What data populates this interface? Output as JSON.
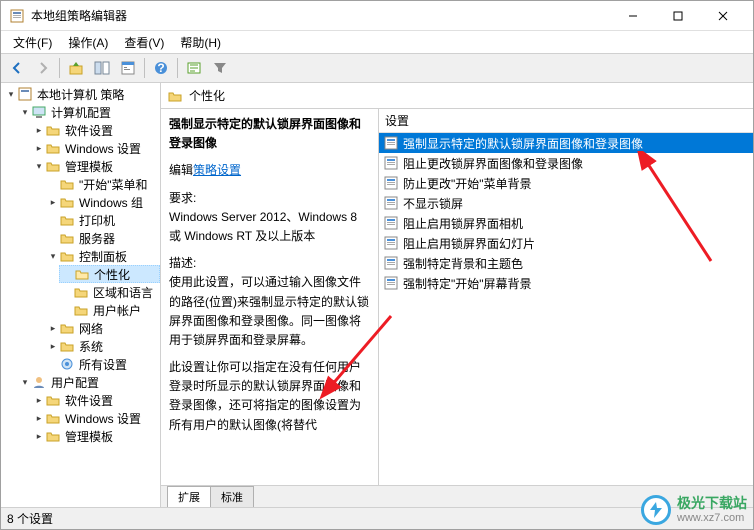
{
  "window": {
    "title": "本地组策略编辑器",
    "min": "—",
    "max": "☐",
    "close": "✕"
  },
  "menu": {
    "file": "文件(F)",
    "action": "操作(A)",
    "view": "查看(V)",
    "help": "帮助(H)"
  },
  "tree": {
    "root": "本地计算机 策略",
    "computer": "计算机配置",
    "software": "软件设置",
    "windows": "Windows 设置",
    "admin": "管理模板",
    "start": "\"开始\"菜单和",
    "wincomp": "Windows 组",
    "printer": "打印机",
    "server": "服务器",
    "ctrlpanel": "控制面板",
    "personalize": "个性化",
    "region": "区域和语言",
    "useracct": "用户帐户",
    "network": "网络",
    "system": "系统",
    "allsettings": "所有设置",
    "user": "用户配置",
    "software2": "软件设置",
    "windows2": "Windows 设置",
    "admin2": "管理模板"
  },
  "header": {
    "title": "个性化"
  },
  "detail": {
    "title": "强制显示特定的默认锁屏界面图像和登录图像",
    "edit_prefix": "编辑",
    "edit_link": "策略设置",
    "req_label": "要求:",
    "req_text": "Windows Server 2012、Windows 8 或 Windows RT 及以上版本",
    "desc_label": "描述:",
    "desc_text": "使用此设置，可以通过输入图像文件的路径(位置)来强制显示特定的默认锁屏界面图像和登录图像。同一图像将用于锁屏界面和登录屏幕。",
    "desc_text2": "此设置让你可以指定在没有任何用户登录时所显示的默认锁屏界面图像和登录图像，还可将指定的图像设置为所有用户的默认图像(将替代"
  },
  "list": {
    "column": "设置",
    "items": [
      "强制显示特定的默认锁屏界面图像和登录图像",
      "阻止更改锁屏界面图像和登录图像",
      "防止更改\"开始\"菜单背景",
      "不显示锁屏",
      "阻止启用锁屏界面相机",
      "阻止启用锁屏界面幻灯片",
      "强制特定背景和主题色",
      "强制特定\"开始\"屏幕背景"
    ]
  },
  "tabs": {
    "extended": "扩展",
    "standard": "标准"
  },
  "status": {
    "text": "8 个设置"
  },
  "watermark": {
    "name": "极光下载站",
    "url": "www.xz7.com"
  }
}
